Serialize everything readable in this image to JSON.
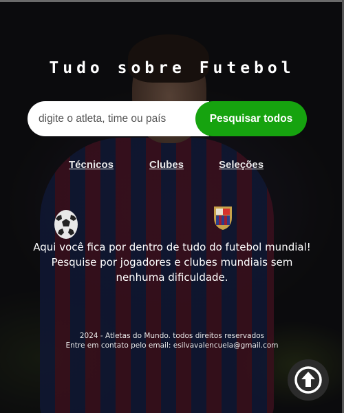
{
  "header": {
    "title": "Tudo sobre Futebol"
  },
  "search": {
    "placeholder": "digite o atleta, time ou país",
    "button_label": "Pesquisar todos"
  },
  "nav": {
    "items": [
      {
        "label": "Técnicos"
      },
      {
        "label": "Clubes"
      },
      {
        "label": "Seleções"
      }
    ]
  },
  "main": {
    "description_line1": "Aqui você fica por dentro de tudo do futebol mundial!",
    "description_line2": "Pesquise por jogadores e clubes mundiais sem",
    "description_line3": "nenhuma dificuldade."
  },
  "footer": {
    "copyright": "2024 - Atletas do Mundo. todos direitos reservados",
    "contact": "Entre em contato pelo email: esilvavalencuela@gmail.com"
  },
  "background": {
    "accent": "#16a30f",
    "icons": [
      "soccer-ball-icon",
      "club-crest-icon",
      "arrow-up-icon"
    ]
  }
}
